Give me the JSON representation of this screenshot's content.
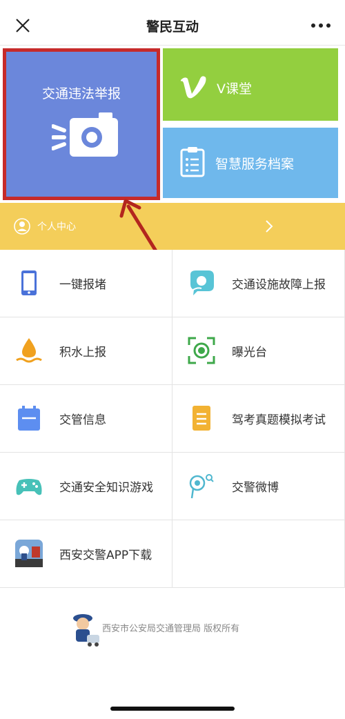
{
  "header": {
    "title": "警民互动"
  },
  "tiles": {
    "report": {
      "label": "交通违法举报"
    },
    "vclass": {
      "label": "V课堂"
    },
    "archive": {
      "label": "智慧服务档案"
    }
  },
  "personal_center": {
    "label": "个人中心"
  },
  "grid": [
    {
      "label": "一键报堵",
      "icon": "phone-icon"
    },
    {
      "label": "交通设施故障上报",
      "icon": "chat-bubble-icon"
    },
    {
      "label": "积水上报",
      "icon": "water-drop-icon"
    },
    {
      "label": "曝光台",
      "icon": "focus-eye-icon"
    },
    {
      "label": "交管信息",
      "icon": "calendar-icon"
    },
    {
      "label": "驾考真题模拟考试",
      "icon": "document-icon"
    },
    {
      "label": "交通安全知识游戏",
      "icon": "gamepad-icon"
    },
    {
      "label": "交警微博",
      "icon": "weibo-icon"
    },
    {
      "label": "西安交警APP下载",
      "icon": "app-logo-icon"
    }
  ],
  "footer": {
    "text": "西安市公安局交通管理局  版权所有"
  },
  "colors": {
    "report_tile": "#6b87db",
    "report_highlight_border": "#c62a2a",
    "vclass_tile": "#93cf3f",
    "archive_tile": "#6fb8ec",
    "personal_bar": "#f4ce5a"
  }
}
